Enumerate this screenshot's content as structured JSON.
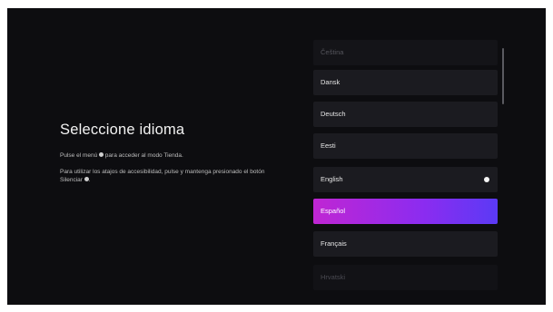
{
  "page": {
    "title": "Seleccione idioma",
    "description_1_before": "Pulse el menú ",
    "description_1_after": " para acceder al modo Tienda.",
    "description_2_before": "Para utilizar los atajos de accesibilidad, pulse y mantenga presionado el botón Silenciar ",
    "description_2_after": "."
  },
  "languages": [
    {
      "label": "Čeština",
      "state": "faded"
    },
    {
      "label": "Dansk",
      "state": "normal"
    },
    {
      "label": "Deutsch",
      "state": "normal"
    },
    {
      "label": "Eesti",
      "state": "normal"
    },
    {
      "label": "English",
      "state": "current"
    },
    {
      "label": "Español",
      "state": "focused"
    },
    {
      "label": "Français",
      "state": "normal"
    },
    {
      "label": "Hrvatski",
      "state": "faded"
    }
  ],
  "colors": {
    "background": "#0d0d10",
    "item_background": "#1b1b20",
    "focus_gradient_start": "#c026d3",
    "focus_gradient_end": "#5b3af5"
  },
  "icons": {
    "menu_button": "menu-button-icon",
    "mute_button": "mute-button-icon",
    "current_language": "radio-selected-icon"
  }
}
